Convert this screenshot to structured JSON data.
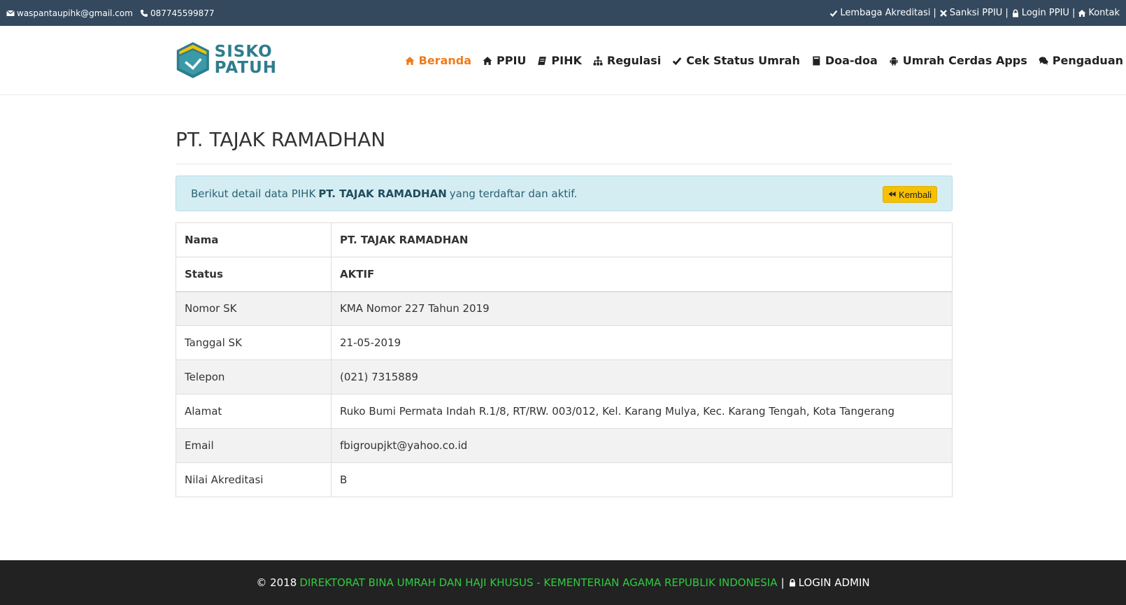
{
  "topbar": {
    "email": "waspantaupihk@gmail.com",
    "phone": "087745599877",
    "links": [
      {
        "label": "Lembaga Akreditasi",
        "icon": "check-icon"
      },
      {
        "label": "Sanksi PPIU",
        "icon": "times-icon"
      },
      {
        "label": "Login PPIU",
        "icon": "lock-icon"
      },
      {
        "label": "Kontak",
        "icon": "home-icon"
      }
    ],
    "separator": "|"
  },
  "logo": {
    "line1": "SISKO",
    "line2": "PATUH"
  },
  "nav": [
    {
      "label": "Beranda",
      "icon": "home-icon",
      "active": true
    },
    {
      "label": "PPIU",
      "icon": "home-icon"
    },
    {
      "label": "PIHK",
      "icon": "book-icon"
    },
    {
      "label": "Regulasi",
      "icon": "sitemap-icon"
    },
    {
      "label": "Cek Status Umrah",
      "icon": "check-icon"
    },
    {
      "label": "Doa-doa",
      "icon": "book-icon"
    },
    {
      "label": "Umrah Cerdas Apps",
      "icon": "android-icon"
    },
    {
      "label": "Pengaduan",
      "icon": "comments-icon"
    }
  ],
  "page": {
    "title": "PT. TAJAK RAMADHAN"
  },
  "alert": {
    "prefix": "Berikut detail data PIHK",
    "name": "PT. TAJAK RAMADHAN",
    "suffix": "yang terdaftar dan aktif.",
    "back_label": "Kembali"
  },
  "details": {
    "nama_label": "Nama",
    "nama_value": "PT. TAJAK RAMADHAN",
    "status_label": "Status",
    "status_value": "AKTIF",
    "sk_label": "Nomor SK",
    "sk_value": "KMA Nomor 227 Tahun 2019",
    "tgl_label": "Tanggal SK",
    "tgl_value": "21-05-2019",
    "telp_label": "Telepon",
    "telp_value": "(021) 7315889",
    "alamat_label": "Alamat",
    "alamat_value": "Ruko Bumi Permata Indah R.1/8, RT/RW. 003/012, Kel. Karang Mulya, Kec. Karang Tengah, Kota Tangerang",
    "email_label": "Email",
    "email_value": "fbigroupjkt@yahoo.co.id",
    "akreditasi_label": "Nilai Akreditasi",
    "akreditasi_value": "B"
  },
  "footer": {
    "copyright": "© 2018",
    "org": "DIREKTORAT BINA UMRAH DAN HAJI KHUSUS - KEMENTERIAN AGAMA REPUBLIK INDONESIA",
    "separator": "|",
    "login": "LOGIN ADMIN"
  },
  "colors": {
    "topbar": "#34495e",
    "nav_active": "#f07c1b",
    "alert_bg": "#d4edf3",
    "button": "#f5c106",
    "footer_bg": "#222222",
    "footer_org": "#2ecc40",
    "logo": "#2e7d8c"
  }
}
